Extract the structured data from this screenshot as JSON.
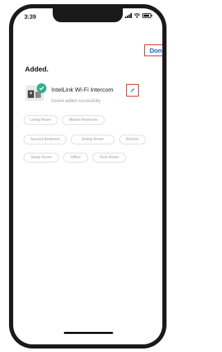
{
  "status_bar": {
    "time": "3:39"
  },
  "header": {
    "done_label": "Done"
  },
  "main": {
    "title": "Added.",
    "device": {
      "name": "IntelLink Wi-Fi Intercom",
      "status": "Device added successfully"
    },
    "rooms": [
      "Living Room",
      "Master Bedroom",
      "Second Bedroom",
      "Dining Room",
      "Kitchen",
      "Study Room",
      "Office",
      "Tech Room"
    ]
  },
  "colors": {
    "accent_blue": "#1a56d6",
    "success_green": "#2fb08f",
    "highlight_red": "#d21e1e"
  }
}
